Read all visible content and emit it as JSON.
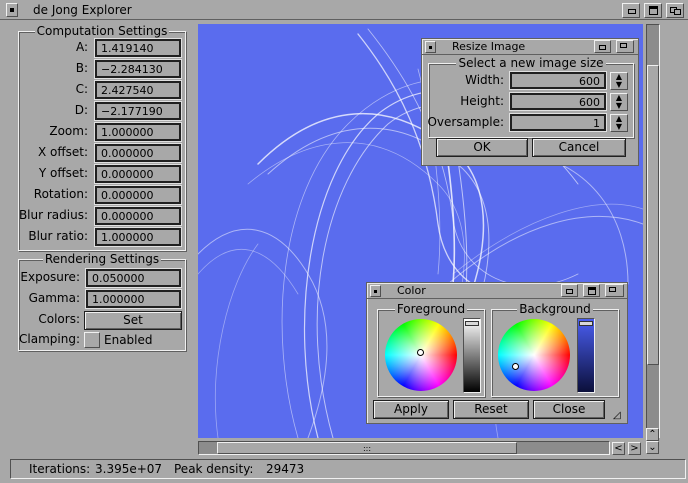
{
  "window": {
    "title": "de Jong Explorer"
  },
  "computation": {
    "title": "Computation Settings",
    "rows": [
      {
        "label": "A:",
        "value": "1.419140"
      },
      {
        "label": "B:",
        "value": "−2.284130"
      },
      {
        "label": "C:",
        "value": "2.427540"
      },
      {
        "label": "D:",
        "value": "−2.177190"
      },
      {
        "label": "Zoom:",
        "value": "1.000000"
      },
      {
        "label": "X offset:",
        "value": "0.000000"
      },
      {
        "label": "Y offset:",
        "value": "0.000000"
      },
      {
        "label": "Rotation:",
        "value": "0.000000"
      },
      {
        "label": "Blur radius:",
        "value": "0.000000"
      },
      {
        "label": "Blur ratio:",
        "value": "1.000000"
      }
    ]
  },
  "rendering": {
    "title": "Rendering Settings",
    "exposure_label": "Exposure:",
    "exposure": "0.050000",
    "gamma_label": "Gamma:",
    "gamma": "1.000000",
    "colors_label": "Colors:",
    "colors_button": "Set",
    "clamping_label": "Clamping:",
    "clamping_text": "Enabled"
  },
  "resize": {
    "title": "Resize Image",
    "group": "Select a new image size",
    "width_label": "Width:",
    "width": "600",
    "height_label": "Height:",
    "height": "600",
    "oversample_label": "Oversample:",
    "oversample": "1",
    "ok": "OK",
    "cancel": "Cancel"
  },
  "color": {
    "title": "Color",
    "foreground": "Foreground",
    "background": "Background",
    "apply": "Apply",
    "reset": "Reset",
    "close": "Close"
  },
  "status": {
    "iterations_label": "Iterations:",
    "iterations": "3.395e+07",
    "peak_label": "Peak density:",
    "peak": "29473"
  },
  "colors": {
    "canvas": "#5a6cee",
    "chrome": "#a8a8a8"
  }
}
